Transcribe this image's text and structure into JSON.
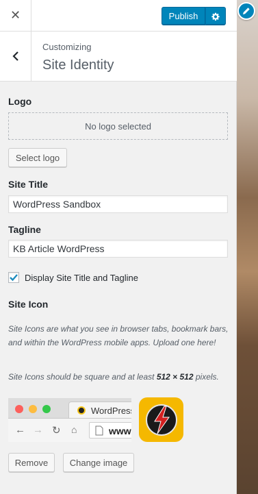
{
  "header": {
    "publish_label": "Publish"
  },
  "section": {
    "breadcrumb": "Customizing",
    "title": "Site Identity"
  },
  "logo": {
    "label": "Logo",
    "empty_text": "No logo selected",
    "select_button": "Select logo"
  },
  "site_title": {
    "label": "Site Title",
    "value": "WordPress Sandbox"
  },
  "tagline": {
    "label": "Tagline",
    "value": "KB Article WordPress"
  },
  "display_checkbox": {
    "label": "Display Site Title and Tagline",
    "checked": true
  },
  "site_icon": {
    "label": "Site Icon",
    "description": "Site Icons are what you see in browser tabs, bookmark bars, and within the WordPress mobile apps. Upload one here!",
    "size_note_prefix": "Site Icons should be square and at least ",
    "size_note_value": "512 × 512",
    "size_note_suffix": " pixels.",
    "preview_tab_title": "WordPress S",
    "preview_url": "www.",
    "remove_button": "Remove",
    "change_button": "Change image"
  },
  "colors": {
    "accent": "#0085ba",
    "icon_bg": "#f5b800"
  },
  "icons": [
    "close-icon",
    "gear-icon",
    "chevron-left-icon",
    "checkmark-icon",
    "pencil-icon",
    "lightning-bolt-icon"
  ]
}
